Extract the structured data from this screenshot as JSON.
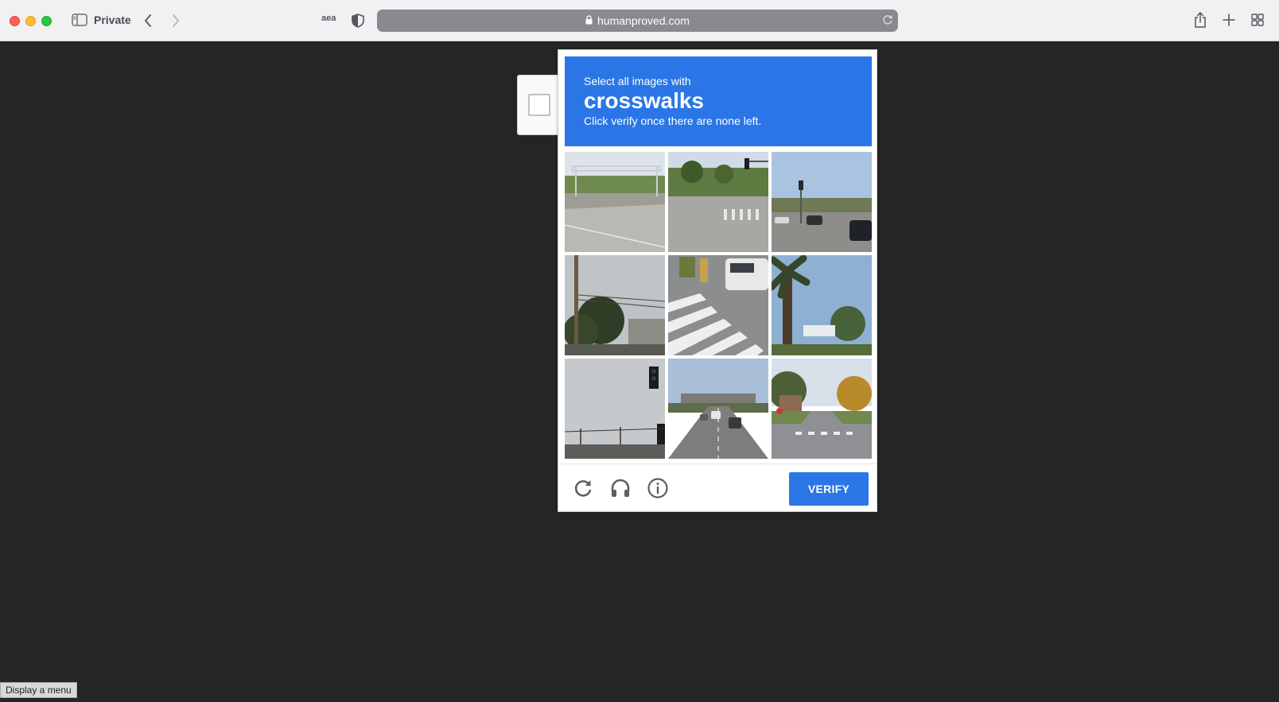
{
  "browser": {
    "private_label": "Private",
    "address": "humanproved.com",
    "extension_label": "aea"
  },
  "captcha": {
    "instruction_prefix": "Select all images with",
    "target": "crosswalks",
    "instruction_suffix": "Click verify once there are none left.",
    "verify_label": "VERIFY",
    "tiles": [
      {
        "name": "tile-1"
      },
      {
        "name": "tile-2"
      },
      {
        "name": "tile-3"
      },
      {
        "name": "tile-4"
      },
      {
        "name": "tile-5"
      },
      {
        "name": "tile-6"
      },
      {
        "name": "tile-7"
      },
      {
        "name": "tile-8"
      },
      {
        "name": "tile-9"
      }
    ]
  },
  "status_tooltip": "Display a menu",
  "colors": {
    "accent": "#2a76e6",
    "page_bg": "#242625"
  }
}
